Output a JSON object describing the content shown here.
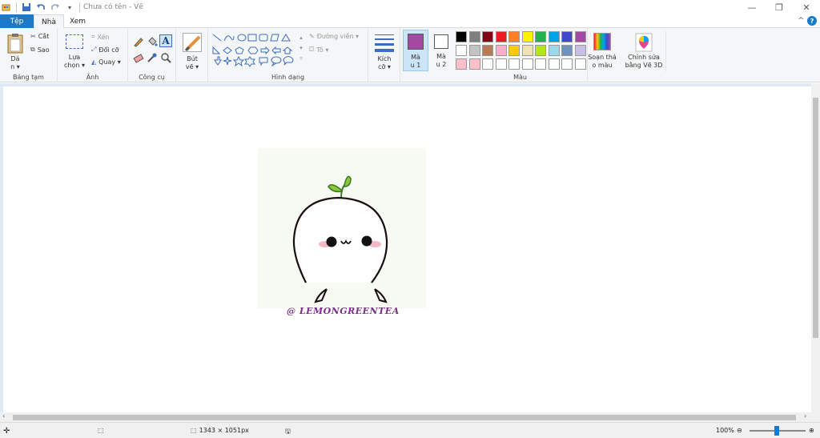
{
  "titlebar": {
    "title": "Chưa có tên - Vẽ"
  },
  "tabs": {
    "file": "Tệp",
    "home": "Nhà",
    "view": "Xem"
  },
  "ribbon": {
    "clipboard": {
      "paste": "Dá\nn ▾",
      "cut": "Cắt",
      "copy": "Sao",
      "label": "Bảng tạm"
    },
    "image": {
      "select": "Lựa\nchọn ▾",
      "crop": "Xén",
      "resize": "Đổi cỡ",
      "rotate": "Quay ▾",
      "label": "Ảnh"
    },
    "tools": {
      "label": "Công cụ"
    },
    "brushes": {
      "label": "Bút\nvẽ ▾"
    },
    "shapes": {
      "outline": "Đường viền ▾",
      "fill": "Tô ▾",
      "label": "Hình dạng"
    },
    "size": {
      "label": "Kích\ncỡ ▾"
    },
    "color1": {
      "label": "Mà\nu 1"
    },
    "color2": {
      "label": "Mà\nu 2"
    },
    "colors": {
      "label": "Màu"
    },
    "edit_colors": {
      "label": "Soạn thả\no màu"
    },
    "paint3d": {
      "label": "Chỉnh sửa\nbằng Vẽ 3D"
    }
  },
  "colors": {
    "accent": "#1979ca",
    "color1": "#a349a4",
    "color2": "#ffffff",
    "palette_row1": [
      "#000000",
      "#7f7f7f",
      "#880015",
      "#ed1c24",
      "#ff7f27",
      "#fff200",
      "#22b14c",
      "#00a2e8",
      "#3f48cc",
      "#a349a4"
    ],
    "palette_row2": [
      "#ffffff",
      "#c3c3c3",
      "#b97a57",
      "#ffaec9",
      "#ffc90e",
      "#efe4b0",
      "#b5e61d",
      "#99d9ea",
      "#7092be",
      "#c8bfe7"
    ],
    "palette_row3": [
      "#ffc0cb",
      "#ffc0cb",
      "#ffffff",
      "#ffffff",
      "#ffffff",
      "#ffffff",
      "#ffffff",
      "#ffffff",
      "#ffffff",
      "#ffffff"
    ]
  },
  "artwork": {
    "caption": "@ LEMONGREENTEA"
  },
  "status": {
    "size": "1343 × 1051px",
    "zoom": "100%"
  }
}
